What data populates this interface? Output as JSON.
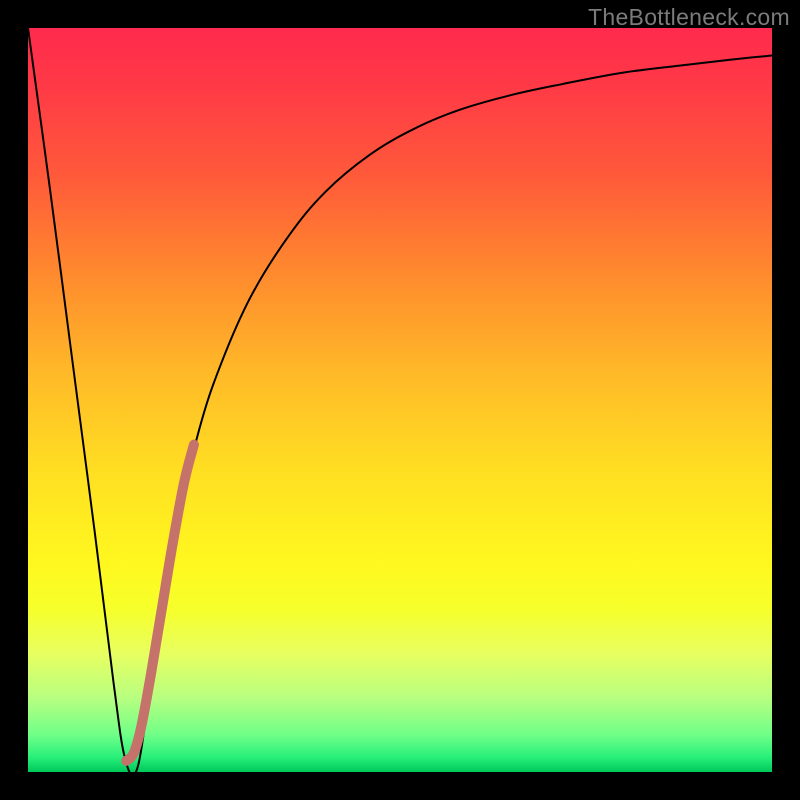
{
  "watermark": "TheBottleneck.com",
  "chart_data": {
    "type": "line",
    "title": "",
    "xlabel": "",
    "ylabel": "",
    "xlim": [
      0,
      100
    ],
    "ylim": [
      0,
      100
    ],
    "grid": false,
    "legend": false,
    "series": [
      {
        "name": "bottleneck-curve",
        "color": "#000000",
        "stroke_width": 2,
        "x": [
          0,
          3,
          6,
          9,
          11.5,
          13,
          14.5,
          16,
          18,
          20,
          23,
          26,
          30,
          35,
          40,
          46,
          52,
          58,
          65,
          72,
          80,
          88,
          95,
          100
        ],
        "y": [
          100,
          78,
          55,
          32,
          12,
          2,
          0,
          8,
          21,
          33,
          46,
          55,
          64,
          72,
          78,
          83,
          86.5,
          89,
          91,
          92.5,
          94,
          95,
          95.8,
          96.3
        ]
      },
      {
        "name": "highlight-segment",
        "color": "#c5726b",
        "stroke_width": 10,
        "x": [
          13.2,
          14.2,
          15.2,
          16.5,
          18,
          19.5,
          21,
          22.3
        ],
        "y": [
          1.5,
          2.5,
          6,
          13,
          22,
          31,
          39,
          44
        ]
      }
    ]
  }
}
